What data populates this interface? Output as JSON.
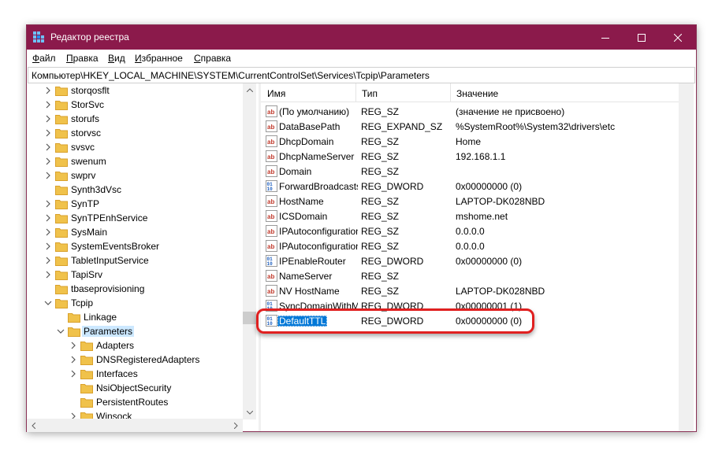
{
  "window": {
    "title": "Редактор реестра"
  },
  "menu": [
    {
      "u": "Ф",
      "rest": "айл"
    },
    {
      "u": "П",
      "rest": "равка"
    },
    {
      "u": "В",
      "rest": "ид"
    },
    {
      "u": "И",
      "rest": "збранное"
    },
    {
      "u": "С",
      "rest": "правка"
    }
  ],
  "address": "Компьютер\\HKEY_LOCAL_MACHINE\\SYSTEM\\CurrentControlSet\\Services\\Tcpip\\Parameters",
  "tree": [
    {
      "label": "storqosflt",
      "level": 0,
      "exp": "collapsed"
    },
    {
      "label": "StorSvc",
      "level": 0,
      "exp": "collapsed"
    },
    {
      "label": "storufs",
      "level": 0,
      "exp": "collapsed"
    },
    {
      "label": "storvsc",
      "level": 0,
      "exp": "collapsed"
    },
    {
      "label": "svsvc",
      "level": 0,
      "exp": "collapsed"
    },
    {
      "label": "swenum",
      "level": 0,
      "exp": "collapsed"
    },
    {
      "label": "swprv",
      "level": 0,
      "exp": "collapsed"
    },
    {
      "label": "Synth3dVsc",
      "level": 0,
      "exp": "none"
    },
    {
      "label": "SynTP",
      "level": 0,
      "exp": "collapsed"
    },
    {
      "label": "SynTPEnhService",
      "level": 0,
      "exp": "collapsed"
    },
    {
      "label": "SysMain",
      "level": 0,
      "exp": "collapsed"
    },
    {
      "label": "SystemEventsBroker",
      "level": 0,
      "exp": "collapsed"
    },
    {
      "label": "TabletInputService",
      "level": 0,
      "exp": "collapsed"
    },
    {
      "label": "TapiSrv",
      "level": 0,
      "exp": "collapsed"
    },
    {
      "label": "tbaseprovisioning",
      "level": 0,
      "exp": "none"
    },
    {
      "label": "Tcpip",
      "level": 0,
      "exp": "expanded"
    },
    {
      "label": "Linkage",
      "level": 1,
      "exp": "none"
    },
    {
      "label": "Parameters",
      "level": 1,
      "exp": "expanded",
      "selected": true
    },
    {
      "label": "Adapters",
      "level": 2,
      "exp": "collapsed"
    },
    {
      "label": "DNSRegisteredAdapters",
      "level": 2,
      "exp": "collapsed"
    },
    {
      "label": "Interfaces",
      "level": 2,
      "exp": "collapsed"
    },
    {
      "label": "NsiObjectSecurity",
      "level": 2,
      "exp": "none"
    },
    {
      "label": "PersistentRoutes",
      "level": 2,
      "exp": "none"
    },
    {
      "label": "Winsock",
      "level": 2,
      "exp": "collapsed"
    }
  ],
  "columns": {
    "name": "Имя",
    "type": "Тип",
    "value": "Значение"
  },
  "rows": [
    {
      "icon": "string-value-icon",
      "name": "(По умолчанию)",
      "type": "REG_SZ",
      "value": "(значение не присвоено)"
    },
    {
      "icon": "string-value-icon",
      "name": "DataBasePath",
      "type": "REG_EXPAND_SZ",
      "value": "%SystemRoot%\\System32\\drivers\\etc"
    },
    {
      "icon": "string-value-icon",
      "name": "DhcpDomain",
      "type": "REG_SZ",
      "value": "Home"
    },
    {
      "icon": "string-value-icon",
      "name": "DhcpNameServer",
      "type": "REG_SZ",
      "value": "192.168.1.1"
    },
    {
      "icon": "string-value-icon",
      "name": "Domain",
      "type": "REG_SZ",
      "value": ""
    },
    {
      "icon": "binary-value-icon",
      "name": "ForwardBroadcasts",
      "type": "REG_DWORD",
      "value": "0x00000000 (0)"
    },
    {
      "icon": "string-value-icon",
      "name": "HostName",
      "type": "REG_SZ",
      "value": "LAPTOP-DK028NBD"
    },
    {
      "icon": "string-value-icon",
      "name": "ICSDomain",
      "type": "REG_SZ",
      "value": "mshome.net"
    },
    {
      "icon": "string-value-icon",
      "name": "IPAutoconfigurationMask",
      "type": "REG_SZ",
      "value": "0.0.0.0"
    },
    {
      "icon": "string-value-icon",
      "name": "IPAutoconfigurationSubnet",
      "type": "REG_SZ",
      "value": "0.0.0.0"
    },
    {
      "icon": "binary-value-icon",
      "name": "IPEnableRouter",
      "type": "REG_DWORD",
      "value": "0x00000000 (0)"
    },
    {
      "icon": "string-value-icon",
      "name": "NameServer",
      "type": "REG_SZ",
      "value": ""
    },
    {
      "icon": "string-value-icon",
      "name": "NV HostName",
      "type": "REG_SZ",
      "value": "LAPTOP-DK028NBD"
    },
    {
      "icon": "binary-value-icon",
      "name": "SyncDomainWithMembership",
      "type": "REG_DWORD",
      "value": "0x00000001 (1)"
    },
    {
      "icon": "binary-value-icon",
      "name": "DefaultTTL",
      "type": "REG_DWORD",
      "value": "0x00000000 (0)",
      "selected": true
    }
  ],
  "colors": {
    "titlebar": "#8b1a4b",
    "selection": "#0078d7",
    "highlight_ring": "#e02020",
    "folder": "#f0c24b"
  }
}
